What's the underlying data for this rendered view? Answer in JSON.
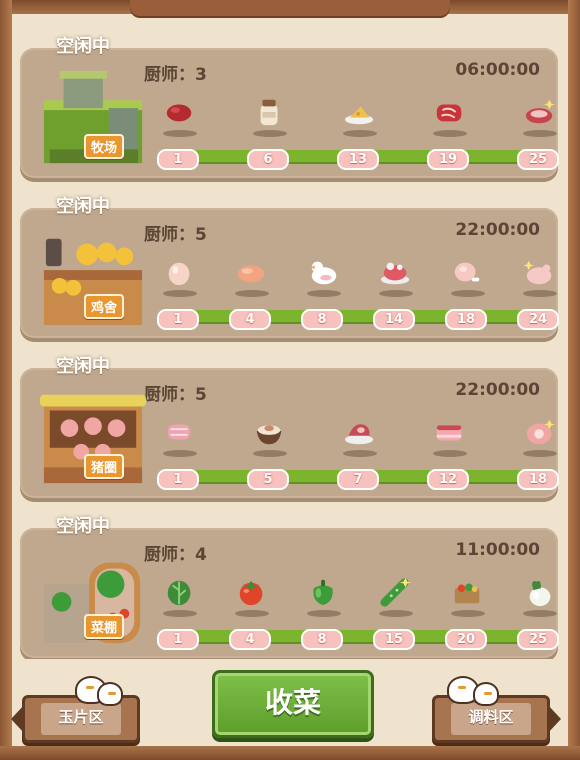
{
  "stations": [
    {
      "status": "空闲中",
      "chefs_label": "厨师：3",
      "timer": "06:00:00",
      "building_name": "牧场",
      "building_icon": "ranch-building-icon",
      "items": [
        {
          "level": "1",
          "icon": "raw-meat-icon"
        },
        {
          "level": "6",
          "icon": "milk-jar-icon"
        },
        {
          "level": "13",
          "icon": "cheese-plate-icon"
        },
        {
          "level": "19",
          "icon": "beef-slice-icon"
        },
        {
          "level": "25",
          "icon": "premium-steak-icon"
        }
      ]
    },
    {
      "status": "空闲中",
      "chefs_label": "厨师：5",
      "timer": "22:00:00",
      "building_name": "鸡舍",
      "building_icon": "chicken-coop-icon",
      "items": [
        {
          "level": "1",
          "icon": "egg-icon"
        },
        {
          "level": "4",
          "icon": "chicken-breast-icon"
        },
        {
          "level": "8",
          "icon": "duck-icon"
        },
        {
          "level": "14",
          "icon": "whole-chicken-icon"
        },
        {
          "level": "18",
          "icon": "chicken-leg-icon"
        },
        {
          "level": "24",
          "icon": "golden-bird-icon"
        }
      ]
    },
    {
      "status": "空闲中",
      "chefs_label": "厨师：5",
      "timer": "22:00:00",
      "building_name": "猪圈",
      "building_icon": "pig-pen-icon",
      "items": [
        {
          "level": "1",
          "icon": "bacon-icon"
        },
        {
          "level": "5",
          "icon": "pork-bowl-icon"
        },
        {
          "level": "7",
          "icon": "pork-cut-icon"
        },
        {
          "level": "12",
          "icon": "pork-belly-icon"
        },
        {
          "level": "18",
          "icon": "ham-icon"
        }
      ]
    },
    {
      "status": "空闲中",
      "chefs_label": "厨师：4",
      "timer": "11:00:00",
      "building_name": "菜棚",
      "building_icon": "greenhouse-icon",
      "items": [
        {
          "level": "1",
          "icon": "cabbage-icon"
        },
        {
          "level": "4",
          "icon": "tomato-icon"
        },
        {
          "level": "8",
          "icon": "green-pepper-icon"
        },
        {
          "level": "15",
          "icon": "cucumber-icon"
        },
        {
          "level": "20",
          "icon": "vegetable-box-icon"
        },
        {
          "level": "25",
          "icon": "radish-icon"
        }
      ]
    }
  ],
  "buttons": {
    "main": "收菜",
    "left": "玉片区",
    "right": "调料区"
  },
  "colors": {
    "card": "#bfa88e",
    "track": "#7cb42e",
    "pill": "#f7c1bd",
    "main_button": "#6faf3a",
    "wood": "#a77450"
  }
}
